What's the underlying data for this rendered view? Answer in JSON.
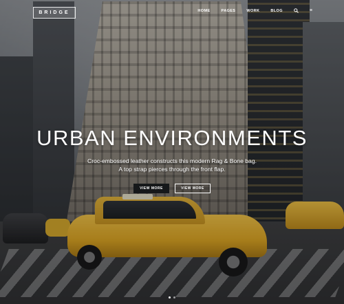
{
  "header": {
    "logo_text": "BRIDGE",
    "nav": [
      {
        "label": "HOME"
      },
      {
        "label": "PAGES"
      },
      {
        "label": "WORK"
      },
      {
        "label": "BLOG"
      }
    ],
    "icons": [
      "search-icon",
      "menu-icon"
    ]
  },
  "hero": {
    "title": "URBAN ENVIRONMENTS",
    "subtitle_line1": "Croc-embossed leather constructs this modern Rag & Bone bag.",
    "subtitle_line2": "A top strap pierces through the front flap.",
    "button_primary": "VIEW MORE",
    "button_secondary": "VIEW MORE",
    "slides_total": 2,
    "active_slide": 1
  },
  "colors": {
    "taxi_yellow": "#e8b22a",
    "dark_button": "#16181a",
    "text": "#ffffff"
  }
}
